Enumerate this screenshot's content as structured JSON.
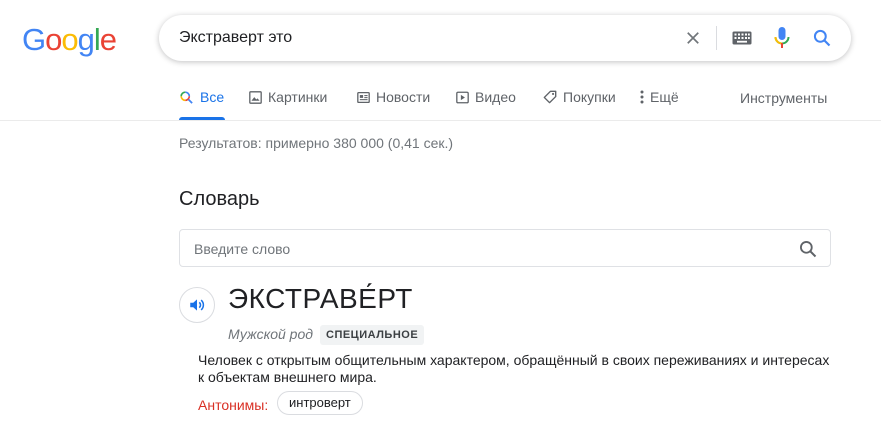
{
  "logo": {
    "letters": [
      "G",
      "o",
      "o",
      "g",
      "l",
      "e"
    ],
    "colors": [
      "#4285f4",
      "#ea4335",
      "#fbbc05",
      "#4285f4",
      "#34a853",
      "#ea4335"
    ]
  },
  "search": {
    "query": "Экстраверт это",
    "icons": [
      "close-icon",
      "keyboard-icon",
      "mic-icon",
      "search-icon"
    ]
  },
  "tabs": [
    {
      "label": "Все",
      "icon": "search-icon",
      "active": true
    },
    {
      "label": "Картинки",
      "icon": "image-icon"
    },
    {
      "label": "Новости",
      "icon": "news-icon"
    },
    {
      "label": "Видео",
      "icon": "play-icon"
    },
    {
      "label": "Покупки",
      "icon": "tag-icon"
    },
    {
      "label": "Ещё",
      "icon": "more-vert-icon"
    }
  ],
  "tools_label": "Инструменты",
  "result_stats": "Результатов: примерно 380 000 (0,41 сек.)",
  "dictionary": {
    "title": "Словарь",
    "input_placeholder": "Введите слово",
    "word": "ЭКСТРАВЕ́РТ",
    "gender": "Мужской род",
    "badge": "СПЕЦИАЛЬНОЕ",
    "definition": "Человек с открытым общительным характером, обращённый в своих переживаниях и интересах к объектам внешнего мира.",
    "antonyms_label": "Антонимы:",
    "antonyms": [
      "интроверт"
    ]
  },
  "colors": {
    "accent": "#1a73e8",
    "antonym_label": "#d93025",
    "muted_text": "#70757a"
  }
}
